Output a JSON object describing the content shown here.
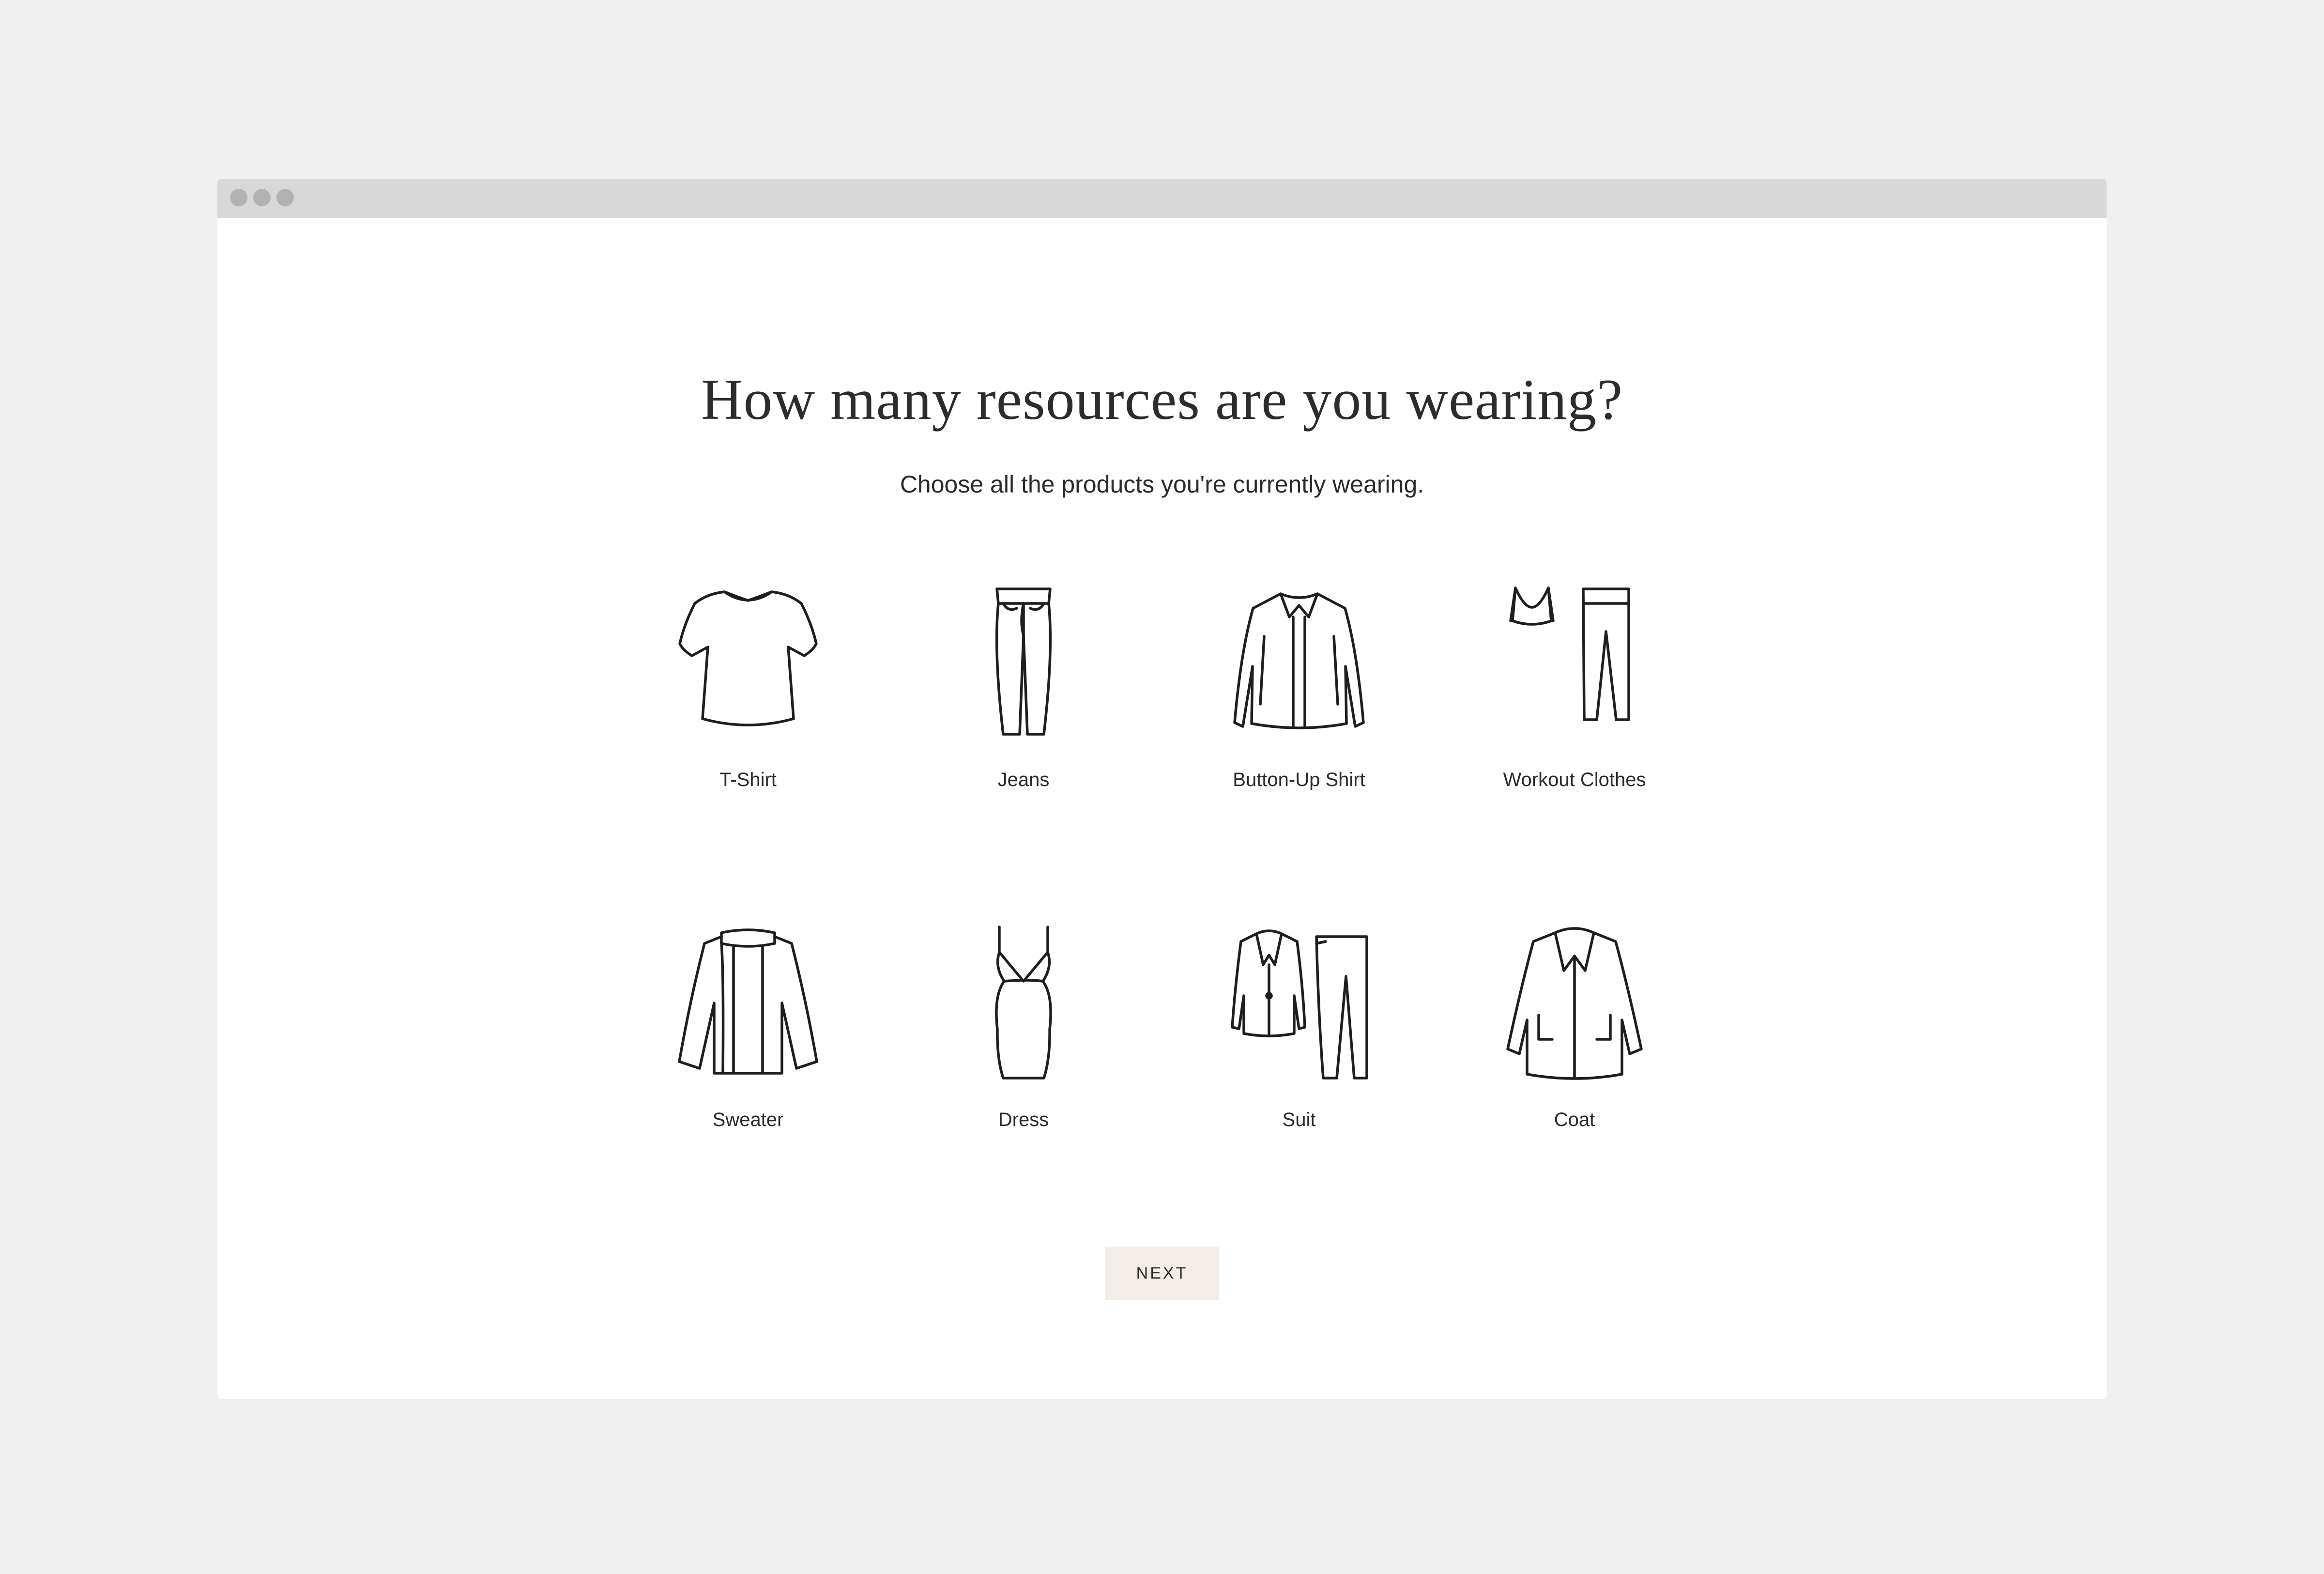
{
  "window": {
    "controls": [
      "close",
      "minimize",
      "maximize"
    ]
  },
  "question": {
    "title": "How many resources are you wearing?",
    "subtitle": "Choose all the products you're currently wearing."
  },
  "products": [
    {
      "label": "T-Shirt",
      "icon": "t-shirt-icon"
    },
    {
      "label": "Jeans",
      "icon": "jeans-icon"
    },
    {
      "label": "Button-Up Shirt",
      "icon": "button-up-shirt-icon"
    },
    {
      "label": "Workout Clothes",
      "icon": "workout-clothes-icon"
    },
    {
      "label": "Sweater",
      "icon": "sweater-icon"
    },
    {
      "label": "Dress",
      "icon": "dress-icon"
    },
    {
      "label": "Suit",
      "icon": "suit-icon"
    },
    {
      "label": "Coat",
      "icon": "coat-icon"
    }
  ],
  "actions": {
    "next_label": "NEXT"
  },
  "colors": {
    "page_background": "#f0f0f0",
    "titlebar": "#d8d8d8",
    "window_controls": "#b2b2b2",
    "next_button_background": "#f4ede7",
    "text": "#222222"
  }
}
